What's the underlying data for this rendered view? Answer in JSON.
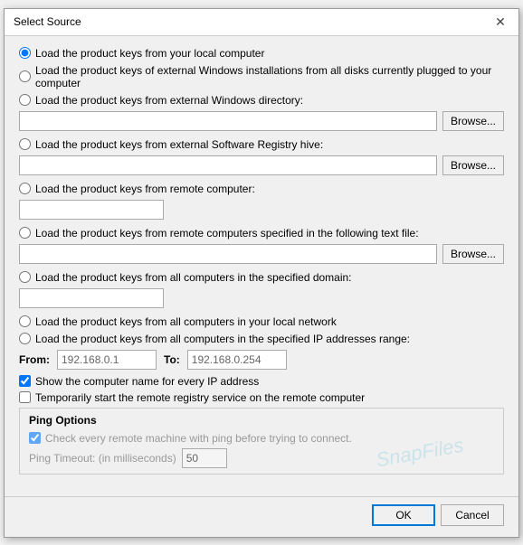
{
  "dialog": {
    "title": "Select Source",
    "close_label": "✕"
  },
  "options": [
    {
      "id": "opt1",
      "label": "Load the product keys from your local computer",
      "checked": true
    },
    {
      "id": "opt2",
      "label": "Load the product keys of external Windows installations from all disks currently plugged to your computer",
      "checked": false
    },
    {
      "id": "opt3",
      "label": "Load the product keys from external Windows directory:",
      "checked": false
    },
    {
      "id": "opt4",
      "label": "Load the product keys from external Software Registry hive:",
      "checked": false
    },
    {
      "id": "opt5",
      "label": "Load the product keys from remote computer:",
      "checked": false
    },
    {
      "id": "opt6",
      "label": "Load the product keys from remote computers specified in the following text file:",
      "checked": false
    },
    {
      "id": "opt7",
      "label": "Load the product keys from all computers in the specified domain:",
      "checked": false
    },
    {
      "id": "opt8",
      "label": "Load the product keys from all computers in your local network",
      "checked": false
    },
    {
      "id": "opt9",
      "label": "Load the product keys from all computers in the specified IP addresses range:",
      "checked": false
    }
  ],
  "inputs": {
    "directory_placeholder": "",
    "registry_placeholder": "",
    "remote_computer_placeholder": "",
    "text_file_placeholder": "",
    "domain_placeholder": "",
    "from_value": "192.168.0.1",
    "to_value": "192.168.0.254",
    "ping_timeout_value": "50"
  },
  "labels": {
    "from": "From:",
    "to": "To:",
    "browse": "Browse...",
    "show_computer_name": "Show the computer name for every IP address",
    "temp_start": "Temporarily start the remote registry service on the remote computer",
    "ping_options": "Ping Options",
    "ping_check": "Check every remote machine with ping before trying to connect.",
    "ping_timeout": "Ping Timeout: (in milliseconds)",
    "ok": "OK",
    "cancel": "Cancel"
  },
  "watermark": "SnapFiles"
}
